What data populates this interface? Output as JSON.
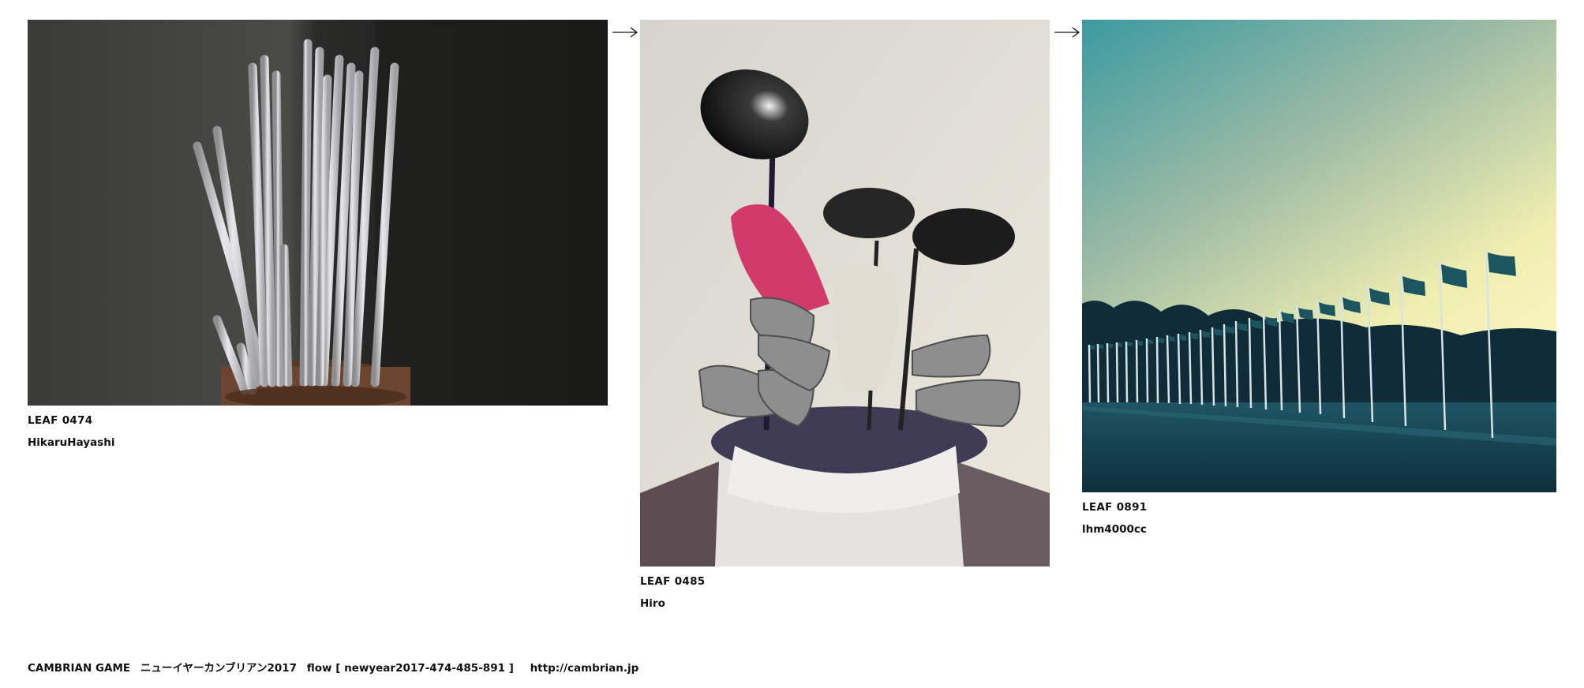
{
  "leaves": [
    {
      "id": "LEAF 0474",
      "author": "HikaruHayashi",
      "image": "fluorescent-tubes-in-basket"
    },
    {
      "id": "LEAF 0485",
      "author": "Hiro",
      "image": "golf-bag-with-clubs"
    },
    {
      "id": "LEAF 0891",
      "author": "lhm4000cc",
      "image": "flags-at-dusk"
    }
  ],
  "footer": {
    "game": "CAMBRIAN GAME",
    "title": "ニューイヤーカンブリアン2017",
    "flow": "flow [ newyear2017-474-485-891 ]",
    "url": "http://cambrian.jp"
  },
  "icons": {
    "arrow": "right-arrow-icon"
  }
}
